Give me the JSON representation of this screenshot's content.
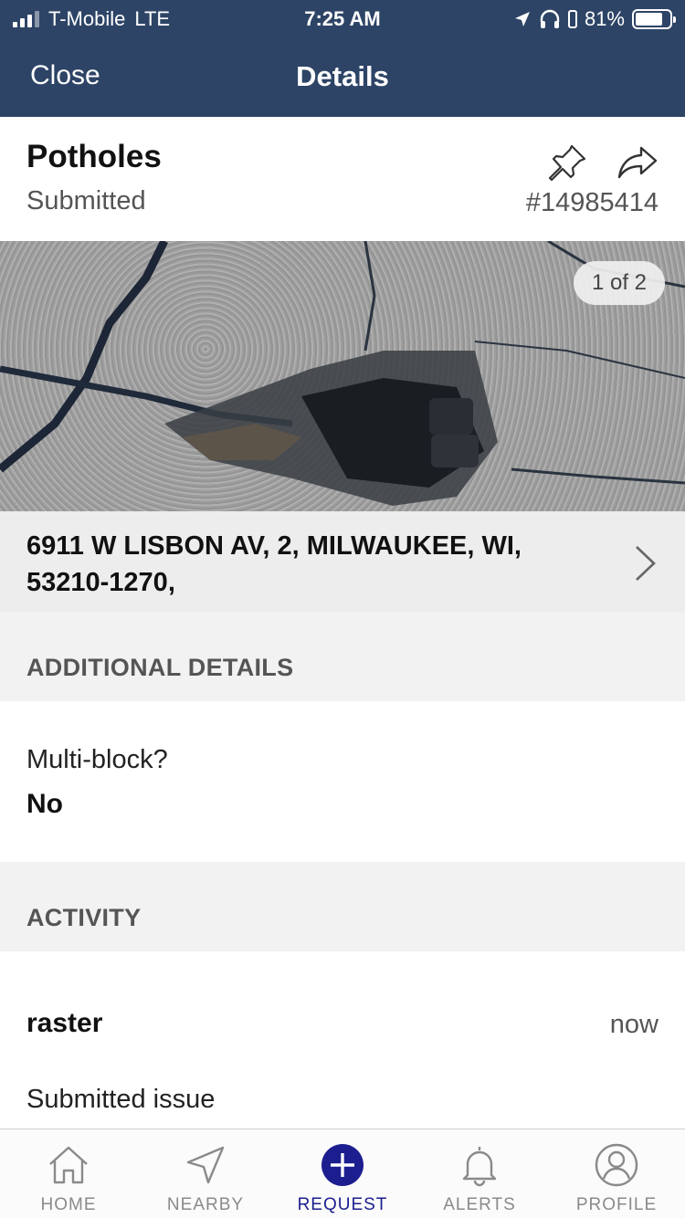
{
  "status_bar": {
    "carrier": "T-Mobile",
    "network": "LTE",
    "time": "7:25 AM",
    "battery": "81%",
    "battery_level": 0.81
  },
  "nav": {
    "close_label": "Close",
    "title": "Details"
  },
  "request": {
    "category": "Potholes",
    "status": "Submitted",
    "id": "#14985414",
    "pin_icon": "pushpin-icon",
    "share_icon": "share-arrow-icon"
  },
  "photo": {
    "counter": "1 of 2"
  },
  "address": {
    "text": "6911 W LISBON AV, 2, MILWAUKEE, WI, 53210-1270,"
  },
  "additional_details": {
    "heading": "ADDITIONAL DETAILS",
    "question": "Multi-block?",
    "answer": "No"
  },
  "activity": {
    "heading": "ACTIVITY",
    "items": [
      {
        "user": "raster",
        "time": "now",
        "description": "Submitted issue"
      }
    ]
  },
  "tabs": [
    {
      "label": "HOME",
      "icon": "home-icon",
      "active": false
    },
    {
      "label": "NEARBY",
      "icon": "navigation-arrow-icon",
      "active": false
    },
    {
      "label": "REQUEST",
      "icon": "plus-circle-icon",
      "active": true
    },
    {
      "label": "ALERTS",
      "icon": "bell-icon",
      "active": false
    },
    {
      "label": "PROFILE",
      "icon": "user-circle-icon",
      "active": false
    }
  ],
  "colors": {
    "header_bg": "#2d4466",
    "active_tab": "#1c1e8f",
    "section_bg": "#f2f2f2"
  }
}
